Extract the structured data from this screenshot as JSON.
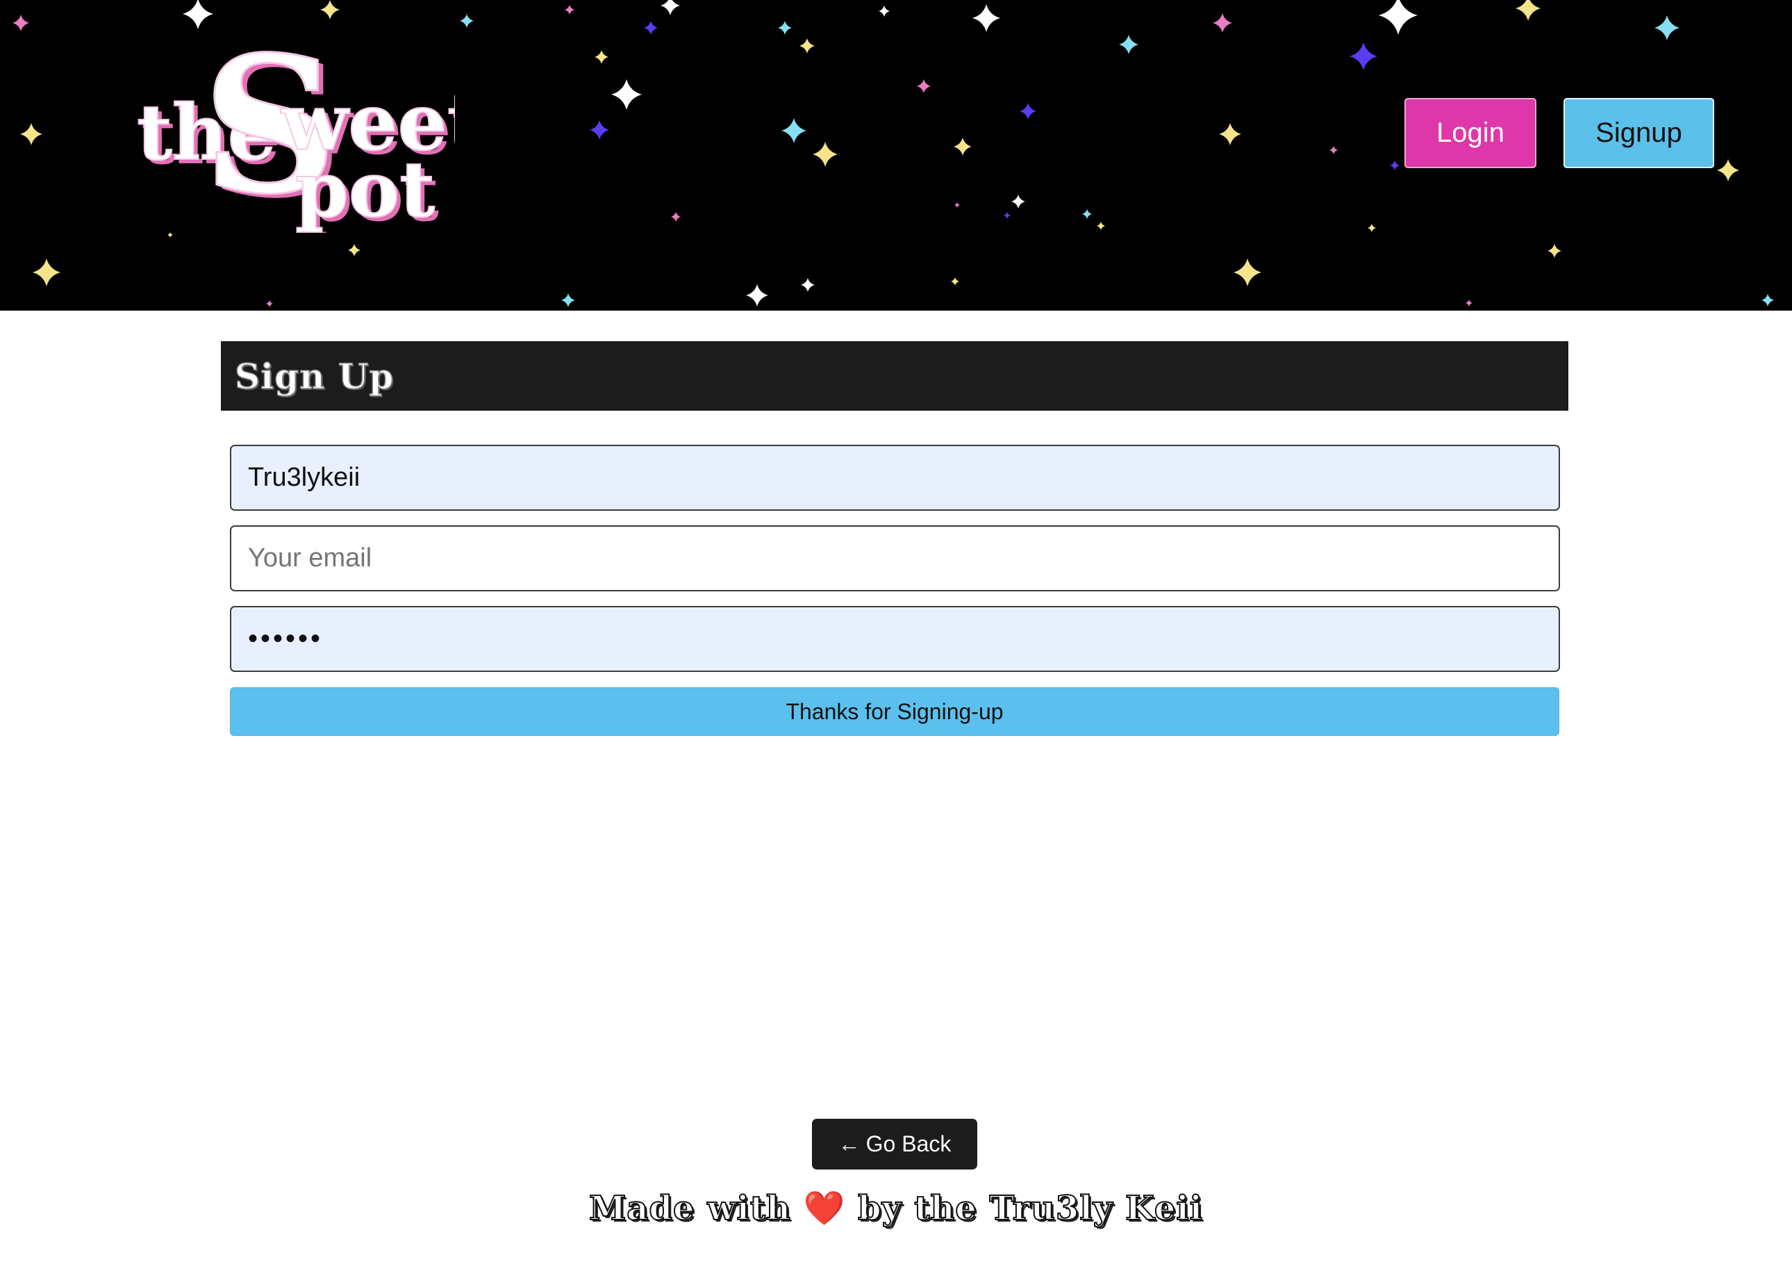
{
  "header": {
    "logo_text_the": "the",
    "logo_text_s": "S",
    "logo_text_weet": "weet",
    "logo_text_pot": "pot",
    "login_label": "Login",
    "signup_label": "Signup"
  },
  "form": {
    "title": "Sign Up",
    "username_value": "Tru3lykeii",
    "email_placeholder": "Your email",
    "password_value": "••••••",
    "submit_label": "Thanks for Signing-up"
  },
  "footer": {
    "go_back_arrow": "←",
    "go_back_label": "Go Back",
    "made_with": "Made with",
    "heart": "❤️",
    "by_text": "by the Tru3ly Keii"
  },
  "colors": {
    "header_bg": "#000000",
    "login_button": "#de37a9",
    "signup_button": "#5bc0ea",
    "submit_button": "#5bc0ed",
    "card_header": "#1c1c1c",
    "autofill_field": "#e8f0fe"
  },
  "icons": {
    "decor": "sparkle-star-icon",
    "back": "arrow-left-icon",
    "heart": "heart-icon"
  }
}
